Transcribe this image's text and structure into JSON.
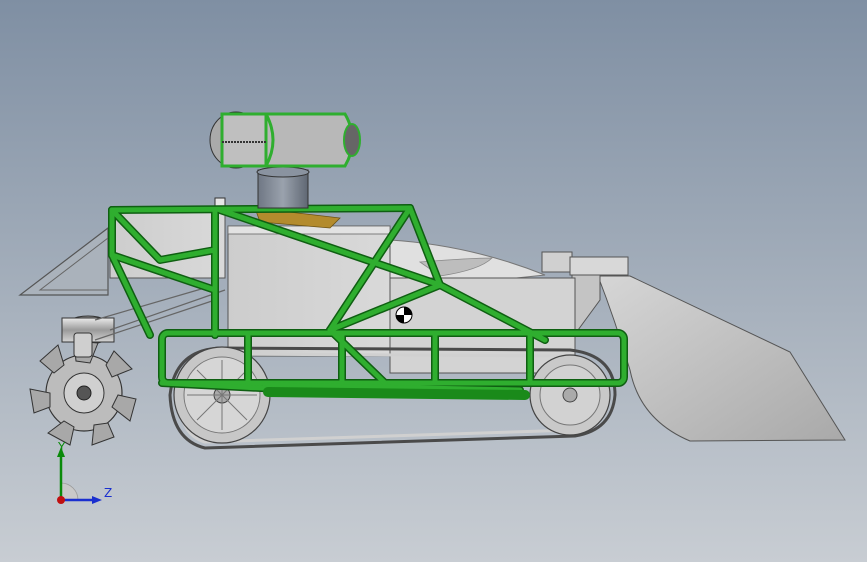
{
  "viewport": {
    "background_top": "#7f8fa3",
    "background_bottom": "#c8cdd3"
  },
  "model": {
    "frame_color": "#2fae2f",
    "frame_outline": "#0f5f12",
    "body_color": "#cfcfcf",
    "track_color": "#a9a9a9",
    "outline_color": "#444444",
    "accent_color": "#b38b2d"
  },
  "axis_triad": {
    "y_label": "Y",
    "z_label": "Z",
    "y_color": "#0a8a0a",
    "z_color": "#1a2fcf",
    "origin_color": "#c01010"
  }
}
